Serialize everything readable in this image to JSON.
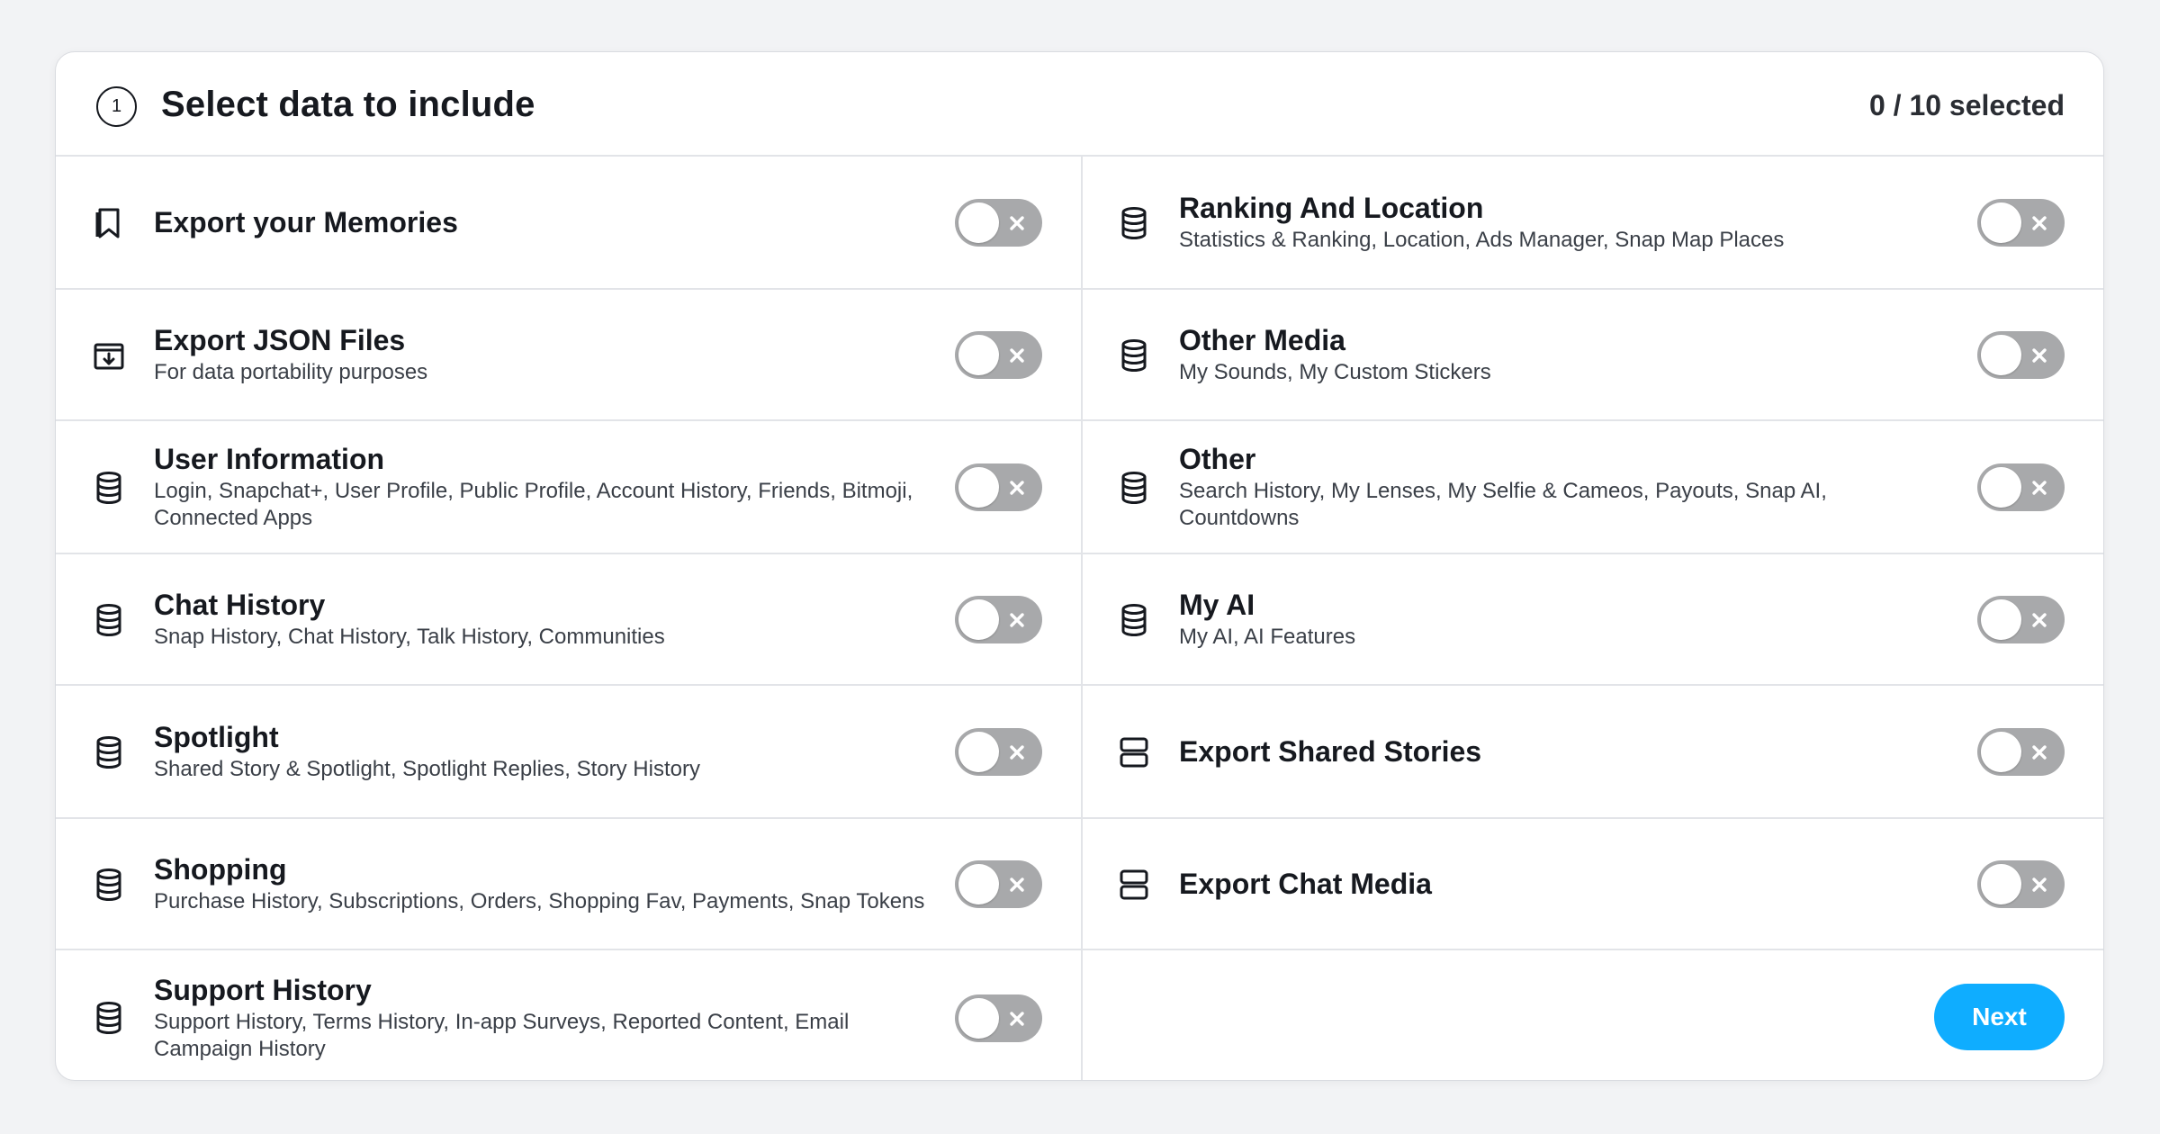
{
  "header": {
    "step_number": "1",
    "title": "Select data to include",
    "selected_count": "0 / 10 selected"
  },
  "left_column": [
    {
      "title": "Export your Memories",
      "description": "",
      "icon": "bookmark-icon",
      "enabled": false
    },
    {
      "title": "Export JSON Files",
      "description": "For data portability purposes",
      "icon": "archive-download-icon",
      "enabled": false
    },
    {
      "title": "User Information",
      "description": "Login, Snapchat+, User Profile, Public Profile, Account History, Friends, Bitmoji, Connected Apps",
      "icon": "database-icon",
      "enabled": false
    },
    {
      "title": "Chat History",
      "description": "Snap History, Chat History, Talk History, Communities",
      "icon": "database-icon",
      "enabled": false
    },
    {
      "title": "Spotlight",
      "description": "Shared Story & Spotlight, Spotlight Replies, Story History",
      "icon": "database-icon",
      "enabled": false
    },
    {
      "title": "Shopping",
      "description": "Purchase History, Subscriptions, Orders, Shopping Fav, Payments, Snap Tokens",
      "icon": "database-icon",
      "enabled": false
    },
    {
      "title": "Support History",
      "description": "Support History, Terms History, In-app Surveys, Reported Content, Email Campaign History",
      "icon": "database-icon",
      "enabled": false
    }
  ],
  "right_column": [
    {
      "title": "Ranking And Location",
      "description": "Statistics & Ranking, Location, Ads Manager, Snap Map Places",
      "icon": "database-icon",
      "enabled": false
    },
    {
      "title": "Other Media",
      "description": "My Sounds, My Custom Stickers",
      "icon": "database-icon",
      "enabled": false
    },
    {
      "title": "Other",
      "description": "Search History, My Lenses, My Selfie & Cameos, Payouts, Snap AI, Countdowns",
      "icon": "database-icon",
      "enabled": false
    },
    {
      "title": "My AI",
      "description": "My AI, AI Features",
      "icon": "database-icon",
      "enabled": false
    },
    {
      "title": "Export Shared Stories",
      "description": "",
      "icon": "server-icon",
      "enabled": false
    },
    {
      "title": "Export Chat Media",
      "description": "",
      "icon": "server-icon",
      "enabled": false
    }
  ],
  "actions": {
    "next_label": "Next"
  },
  "colors": {
    "accent": "#0fadff",
    "toggle_off": "#a8a9ab",
    "divider": "#e2e4e8"
  }
}
